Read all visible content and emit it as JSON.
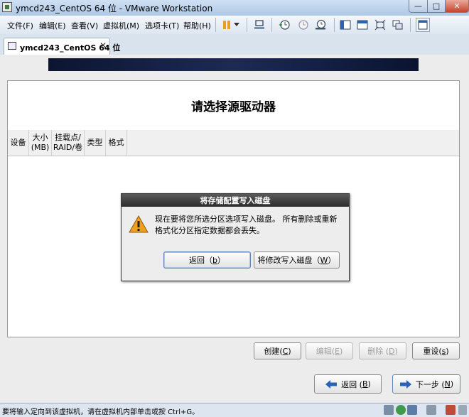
{
  "window": {
    "title": "ymcd243_CentOS 64 位 - VMware Workstation",
    "minimize_glyph": "—",
    "maximize_glyph": "□",
    "close_glyph": "✕"
  },
  "menu": [
    {
      "label": "文件(F)"
    },
    {
      "label": "编辑(E)"
    },
    {
      "label": "查看(V)"
    },
    {
      "label": "虚拟机(M)"
    },
    {
      "label": "选项卡(T)"
    },
    {
      "label": "帮助(H)"
    }
  ],
  "toolbar": {
    "icons": [
      "pause-icon",
      "dropdown-arrow-icon",
      "send-ctrl-alt-del-icon",
      "snapshot-icon",
      "revert-snapshot-icon",
      "snapshot-manager-icon",
      "console-view-icon",
      "full-screen-icon",
      "fit-guest-icon",
      "unity-icon",
      "thumbnail-bar-icon"
    ]
  },
  "tab": {
    "label": "ymcd243_CentOS 64 位",
    "close_glyph": "✕"
  },
  "installer": {
    "title": "请选择源驱动器",
    "columns": [
      "设备",
      "大小\n(MB)",
      "挂载点/\nRAID/卷",
      "类型",
      "格式"
    ],
    "buttons": {
      "create": {
        "text": "创建(",
        "key": "C",
        "end": ")"
      },
      "edit": {
        "text": "编辑(",
        "key": "E",
        "end": ")"
      },
      "delete": {
        "text": "删除 (",
        "key": "D",
        "end": ")"
      },
      "reset": {
        "text": "重设(",
        "key": "s",
        "end": ")"
      }
    },
    "nav": {
      "back": {
        "text": "返回 (",
        "key": "B",
        "end": ")"
      },
      "next": {
        "text": "下一步 (",
        "key": "N",
        "end": ")"
      }
    }
  },
  "dialog": {
    "title": "将存储配置写入磁盘",
    "message": "现在要将您所选分区选项写入磁盘。 所有删除或重新格式化分区指定数据都会丢失。",
    "back_button": {
      "text": "返回（",
      "key": "b",
      "end": "）"
    },
    "write_button": {
      "text": "将修改写入磁盘（",
      "key": "W",
      "end": "）"
    }
  },
  "statusbar": {
    "text": "要将输入定向到该虚拟机，请在虚拟机内部单击或按 Ctrl+G。"
  },
  "colors": {
    "accent": "#2a62b8",
    "warning": "#f0a020"
  }
}
